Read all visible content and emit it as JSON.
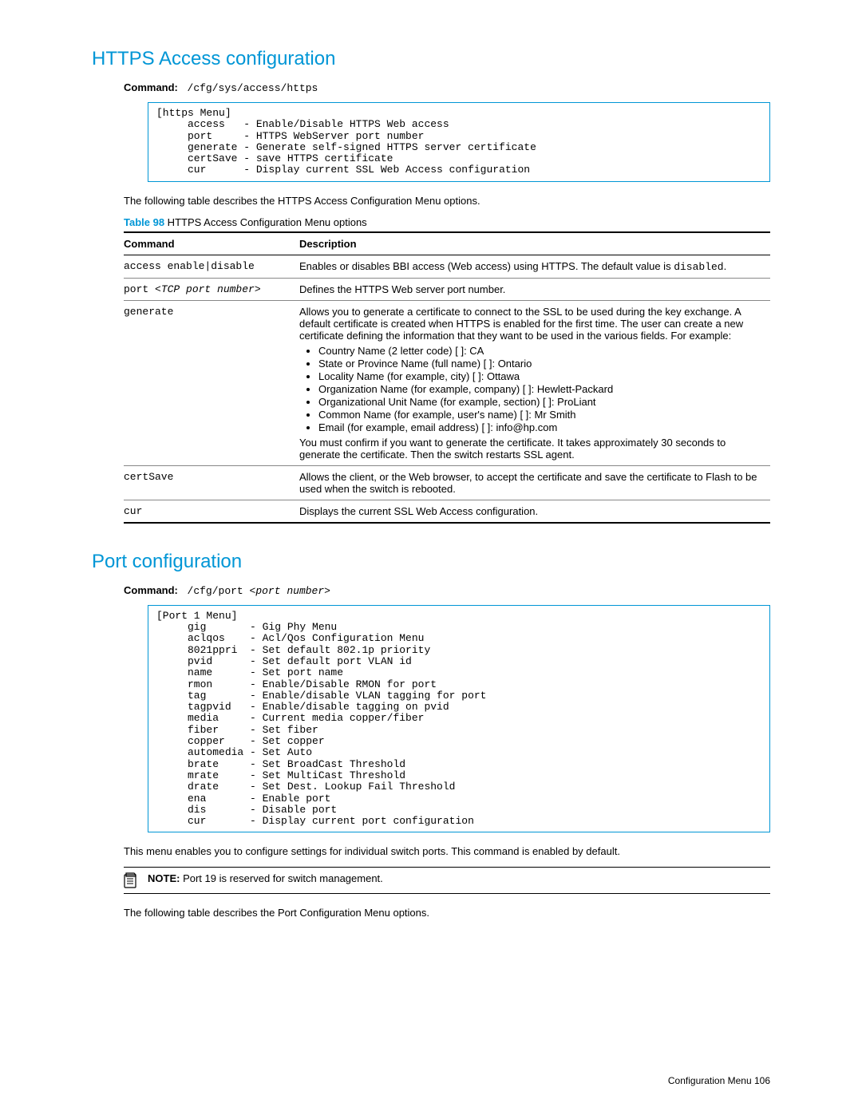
{
  "section1": {
    "title": "HTTPS Access configuration",
    "cmd_label": "Command:",
    "cmd_path": "/cfg/sys/access/https",
    "menu_text": "[https Menu]\n     access   - Enable/Disable HTTPS Web access\n     port     - HTTPS WebServer port number\n     generate - Generate self-signed HTTPS server certificate\n     certSave - save HTTPS certificate\n     cur      - Display current SSL Web Access configuration",
    "intro": "The following table describes the HTTPS Access Configuration Menu options.",
    "table_num": "Table 98",
    "table_title": " HTTPS Access Configuration Menu options",
    "th_cmd": "Command",
    "th_desc": "Description",
    "rows": {
      "r0_cmd": "access enable|disable",
      "r0_desc_a": "Enables or disables BBI access (Web access) using HTTPS. The default value is ",
      "r0_desc_mono": "disabled",
      "r0_desc_b": ".",
      "r1_cmd_a": "port ",
      "r1_cmd_ital": "<TCP port number>",
      "r1_desc": "Defines the HTTPS Web server port number.",
      "r2_cmd": "generate",
      "r2_desc_top": "Allows you to generate a certificate to connect to the SSL to be used during the key exchange. A default certificate is created when HTTPS is enabled for the first time. The user can create a new certificate defining the information that they want to be used in the various fields. For example:",
      "r2_fields": {
        "f0": "Country Name (2 letter code) [  ]:  CA",
        "f1": "State or Province Name (full name) [  ]:  Ontario",
        "f2": "Locality Name (for example, city) [  ]:  Ottawa",
        "f3": "Organization Name (for example, company) [  ]:  Hewlett-Packard",
        "f4": "Organizational Unit Name (for example, section) [  ]:  ProLiant",
        "f5": "Common Name (for example, user's name) [  ]:  Mr Smith",
        "f6": "Email (for example, email address) [  ]:  info@hp.com"
      },
      "r2_desc_bot": "You must confirm if you want to generate the certificate. It takes approximately 30 seconds to generate the certificate. Then the switch restarts SSL agent.",
      "r3_cmd": "certSave",
      "r3_desc": "Allows the client, or the Web browser, to accept the certificate and save the certificate to Flash to be used when the switch is rebooted.",
      "r4_cmd": "cur",
      "r4_desc": "Displays the current SSL Web Access configuration."
    }
  },
  "section2": {
    "title": "Port configuration",
    "cmd_label": "Command:",
    "cmd_path_a": "/cfg/port ",
    "cmd_path_ital": "<port number>",
    "menu_text": "[Port 1 Menu]\n     gig       - Gig Phy Menu\n     aclqos    - Acl/Qos Configuration Menu\n     8021ppri  - Set default 802.1p priority\n     pvid      - Set default port VLAN id\n     name      - Set port name\n     rmon      - Enable/Disable RMON for port\n     tag       - Enable/disable VLAN tagging for port\n     tagpvid   - Enable/disable tagging on pvid\n     media     - Current media copper/fiber\n     fiber     - Set fiber\n     copper    - Set copper\n     automedia - Set Auto\n     brate     - Set BroadCast Threshold\n     mrate     - Set MultiCast Threshold\n     drate     - Set Dest. Lookup Fail Threshold\n     ena       - Enable port\n     dis       - Disable port\n     cur       - Display current port configuration",
    "intro": "This menu enables you to configure settings for individual switch ports. This command is enabled by default.",
    "note_label": "NOTE:",
    "note_text": " Port 19 is reserved for switch management.",
    "outro": "The following table describes the Port Configuration Menu options."
  },
  "footer": {
    "label": "Configuration Menu",
    "page": "106",
    "sep": "   "
  }
}
